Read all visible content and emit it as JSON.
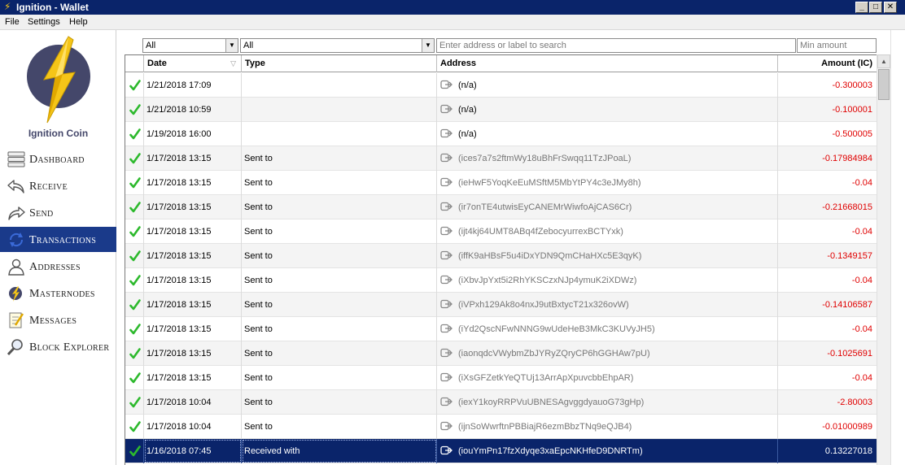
{
  "window": {
    "title": "Ignition - Wallet",
    "controls": {
      "minimize": "_",
      "maximize": "□",
      "close": "✕"
    }
  },
  "menu": [
    "File",
    "Settings",
    "Help"
  ],
  "brand": {
    "name": "Ignition Coin",
    "logo_icon": "ignition-coin-logo",
    "accent": "#f5c518",
    "logo_bg": "#44476a"
  },
  "sidebar": {
    "active_color": "#1a3a8a",
    "items": [
      {
        "label": "Dashboard",
        "icon": "dashboard-icon",
        "active": false
      },
      {
        "label": "Receive",
        "icon": "receive-icon",
        "active": false
      },
      {
        "label": "Send",
        "icon": "send-icon",
        "active": false
      },
      {
        "label": "Transactions",
        "icon": "transactions-icon",
        "active": true
      },
      {
        "label": "Addresses",
        "icon": "addresses-icon",
        "active": false
      },
      {
        "label": "Masternodes",
        "icon": "masternodes-icon",
        "active": false
      },
      {
        "label": "Messages",
        "icon": "messages-icon",
        "active": false
      },
      {
        "label": "Block Explorer",
        "icon": "block-explorer-icon",
        "active": false
      }
    ]
  },
  "filters": {
    "date": "All",
    "type": "All",
    "address_placeholder": "Enter address or label to search",
    "amount_placeholder": "Min amount"
  },
  "table": {
    "columns": {
      "date": "Date",
      "type": "Type",
      "address": "Address",
      "amount": "Amount (IC)"
    },
    "negative_color": "#e00000",
    "rows": [
      {
        "date": "1/21/2018 17:09",
        "type": "",
        "address": "(n/a)",
        "amount": "-0.300003"
      },
      {
        "date": "1/21/2018 10:59",
        "type": "",
        "address": "(n/a)",
        "amount": "-0.100001"
      },
      {
        "date": "1/19/2018 16:00",
        "type": "",
        "address": "(n/a)",
        "amount": "-0.500005"
      },
      {
        "date": "1/17/2018 13:15",
        "type": "Sent to",
        "address": "(ices7a7s2ftmWy18uBhFrSwqq11TzJPoaL)",
        "amount": "-0.17984984"
      },
      {
        "date": "1/17/2018 13:15",
        "type": "Sent to",
        "address": "(ieHwF5YoqKeEuMSftM5MbYtPY4c3eJMy8h)",
        "amount": "-0.04"
      },
      {
        "date": "1/17/2018 13:15",
        "type": "Sent to",
        "address": "(ir7onTE4utwisEyCANEMrWiwfoAjCAS6Cr)",
        "amount": "-0.21668015"
      },
      {
        "date": "1/17/2018 13:15",
        "type": "Sent to",
        "address": "(ijt4kj64UMT8ABq4fZebocyurrexBCTYxk)",
        "amount": "-0.04"
      },
      {
        "date": "1/17/2018 13:15",
        "type": "Sent to",
        "address": "(iffK9aHBsF5u4iDxYDN9QmCHaHXc5E3qyK)",
        "amount": "-0.1349157"
      },
      {
        "date": "1/17/2018 13:15",
        "type": "Sent to",
        "address": "(iXbvJpYxt5i2RhYKSCzxNJp4ymuK2iXDWz)",
        "amount": "-0.04"
      },
      {
        "date": "1/17/2018 13:15",
        "type": "Sent to",
        "address": "(iVPxh129Ak8o4nxJ9utBxtycT21x326ovW)",
        "amount": "-0.14106587"
      },
      {
        "date": "1/17/2018 13:15",
        "type": "Sent to",
        "address": "(iYd2QscNFwNNNG9wUdeHeB3MkC3KUVyJH5)",
        "amount": "-0.04"
      },
      {
        "date": "1/17/2018 13:15",
        "type": "Sent to",
        "address": "(iaonqdcVWybmZbJYRyZQryCP6hGGHAw7pU)",
        "amount": "-0.1025691"
      },
      {
        "date": "1/17/2018 13:15",
        "type": "Sent to",
        "address": "(iXsGFZetkYeQTUj13ArrApXpuvcbbEhpAR)",
        "amount": "-0.04"
      },
      {
        "date": "1/17/2018 10:04",
        "type": "Sent to",
        "address": "(iexY1koyRRPVuUBNESAgvggdyauoG73gHp)",
        "amount": "-2.80003"
      },
      {
        "date": "1/17/2018 10:04",
        "type": "Sent to",
        "address": "(ijnSoWwrftnPBBiajR6ezmBbzTNq9eQJB4)",
        "amount": "-0.01000989"
      },
      {
        "date": "1/16/2018 07:45",
        "type": "Received with",
        "address": "(iouYmPn17fzXdyqe3xaEpcNKHfeD9DNRTm)",
        "amount": "0.13227018",
        "selected": true
      }
    ]
  }
}
